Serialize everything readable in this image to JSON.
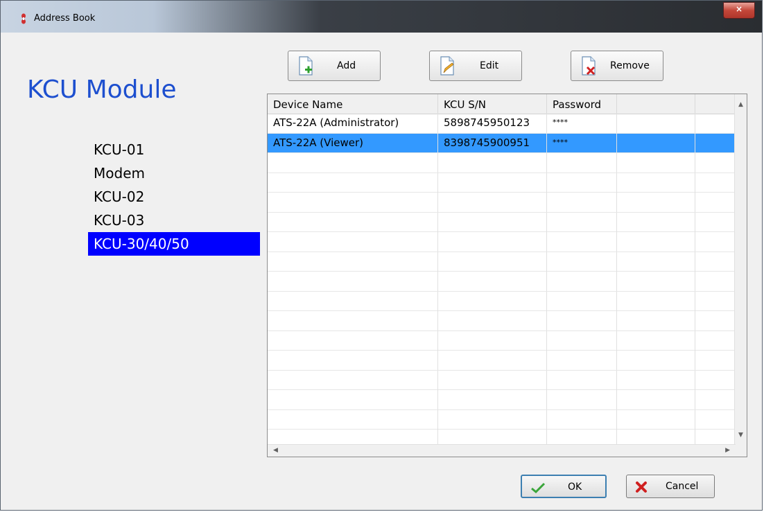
{
  "window": {
    "title": "Address Book",
    "close_symbol": "×"
  },
  "sidebar": {
    "heading": "KCU Module",
    "items": [
      {
        "label": "KCU-01",
        "selected": false
      },
      {
        "label": "Modem",
        "selected": false
      },
      {
        "label": "KCU-02",
        "selected": false
      },
      {
        "label": "KCU-03",
        "selected": false
      },
      {
        "label": "KCU-30/40/50",
        "selected": true
      }
    ]
  },
  "toolbar": {
    "add_label": "Add",
    "edit_label": "Edit",
    "remove_label": "Remove"
  },
  "table": {
    "columns": [
      "Device Name",
      "KCU S/N",
      "Password"
    ],
    "rows": [
      {
        "device_name": "ATS-22A (Administrator)",
        "sn": "5898745950123",
        "password": "****",
        "selected": false
      },
      {
        "device_name": "ATS-22A (Viewer)",
        "sn": "8398745900951",
        "password": "****",
        "selected": true
      }
    ]
  },
  "footer": {
    "ok_label": "OK",
    "cancel_label": "Cancel"
  },
  "colors": {
    "heading": "#1d4fcf",
    "sidebar_selected": "#0000ff",
    "row_selected": "#3399ff"
  }
}
